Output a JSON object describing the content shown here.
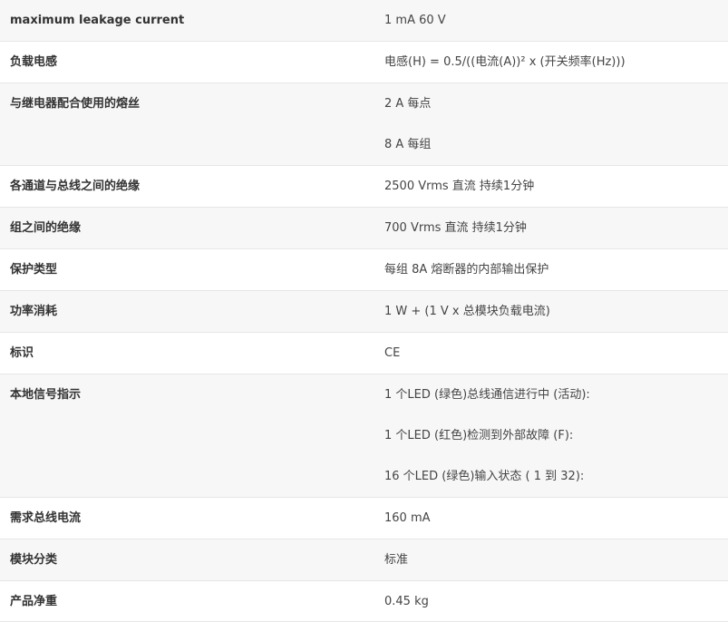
{
  "specs": [
    {
      "label": "maximum leakage current",
      "values": [
        "1 mA 60 V"
      ]
    },
    {
      "label": "负载电感",
      "values": [
        "电感(H) = 0.5/((电流(A))² x (开关频率(Hz)))"
      ]
    },
    {
      "label": "与继电器配合使用的熔丝",
      "values": [
        "2 A 每点",
        "8 A 每组"
      ]
    },
    {
      "label": "各通道与总线之间的绝缘",
      "values": [
        "2500 Vrms 直流 持续1分钟"
      ]
    },
    {
      "label": "组之间的绝缘",
      "values": [
        "700 Vrms 直流 持续1分钟"
      ]
    },
    {
      "label": "保护类型",
      "values": [
        "每组 8A 熔断器的内部输出保护"
      ]
    },
    {
      "label": "功率消耗",
      "values": [
        "1 W + (1 V x 总模块负载电流)"
      ]
    },
    {
      "label": "标识",
      "values": [
        "CE"
      ]
    },
    {
      "label": "本地信号指示",
      "values": [
        "1 个LED (绿色)总线通信进行中 (活动):",
        "1 个LED (红色)检测到外部故障 (F):",
        "16 个LED (绿色)输入状态 ( 1 到 32):"
      ]
    },
    {
      "label": "需求总线电流",
      "values": [
        "160 mA"
      ]
    },
    {
      "label": "模块分类",
      "values": [
        "标准"
      ]
    },
    {
      "label": "产品净重",
      "values": [
        "0.45 kg"
      ]
    }
  ]
}
